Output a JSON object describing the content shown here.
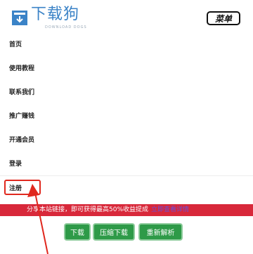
{
  "header": {
    "brand": "下载狗",
    "brand_sub": "DOWNLOAD DOGS",
    "menu_label": "菜单"
  },
  "nav": {
    "items": [
      {
        "label": "首页"
      },
      {
        "label": "使用教程"
      },
      {
        "label": "联系我们"
      },
      {
        "label": "推广赚钱"
      },
      {
        "label": "开通会员"
      },
      {
        "label": "登录"
      },
      {
        "label": "注册"
      }
    ]
  },
  "banner": {
    "text": "分享本站链接，即可获得最高50%收益提成",
    "link": "立即查看详情"
  },
  "actions": {
    "download": "下载",
    "compress_download": "压缩下载",
    "reparse": "重新解析"
  },
  "colors": {
    "brand": "#3b83c7",
    "banner": "#d8283a",
    "button": "#2e9a48",
    "annotation": "#e0281e"
  },
  "icons": [
    "download-box-icon",
    "arrow-annotation"
  ]
}
